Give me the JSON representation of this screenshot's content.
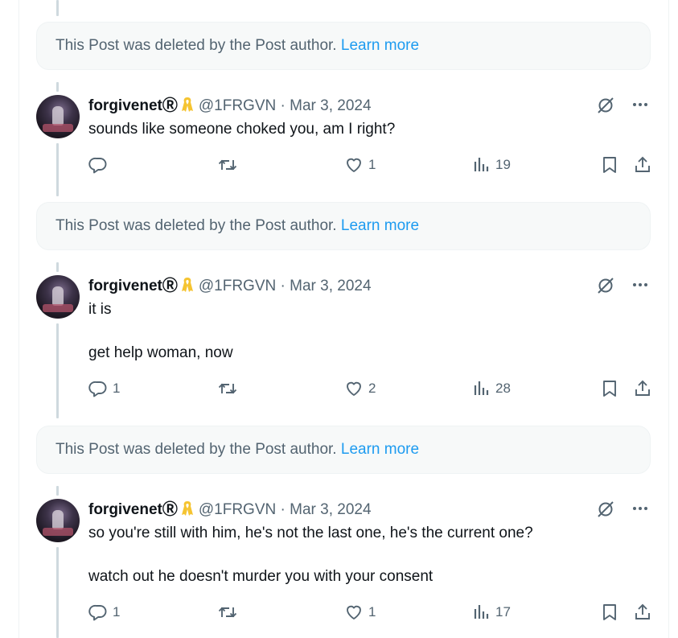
{
  "deleted_notice": {
    "text": "This Post was deleted by the Post author.",
    "link": "Learn more"
  },
  "posts": [
    {
      "name": "forgivenet",
      "badge": "Ⓡ",
      "handle": "@1FRGVN",
      "separator": "·",
      "date": "Mar 3, 2024",
      "text": "sounds like someone choked you, am I right?",
      "replies": "",
      "reposts": "",
      "likes": "1",
      "views": "19"
    },
    {
      "name": "forgivenet",
      "badge": "Ⓡ",
      "handle": "@1FRGVN",
      "separator": "·",
      "date": "Mar 3, 2024",
      "text": "it is\n\nget help woman, now",
      "replies": "1",
      "reposts": "",
      "likes": "2",
      "views": "28"
    },
    {
      "name": "forgivenet",
      "badge": "Ⓡ",
      "handle": "@1FRGVN",
      "separator": "·",
      "date": "Mar 3, 2024",
      "text": "so you're still with him, he's not the last one, he's the current one?\n\nwatch out he doesn't murder you with your consent",
      "replies": "1",
      "reposts": "",
      "likes": "1",
      "views": "17"
    }
  ],
  "icons": {
    "ribbon": "yellow-ribbon-icon",
    "grok": "grok-icon",
    "more": "more-icon",
    "reply": "reply-icon",
    "repost": "repost-icon",
    "like": "like-icon",
    "views": "views-icon",
    "bookmark": "bookmark-icon",
    "share": "share-icon"
  },
  "colors": {
    "link": "#1d9bf0",
    "secondary": "#536471",
    "text": "#0f1419",
    "ribbon": "#f5c431"
  }
}
